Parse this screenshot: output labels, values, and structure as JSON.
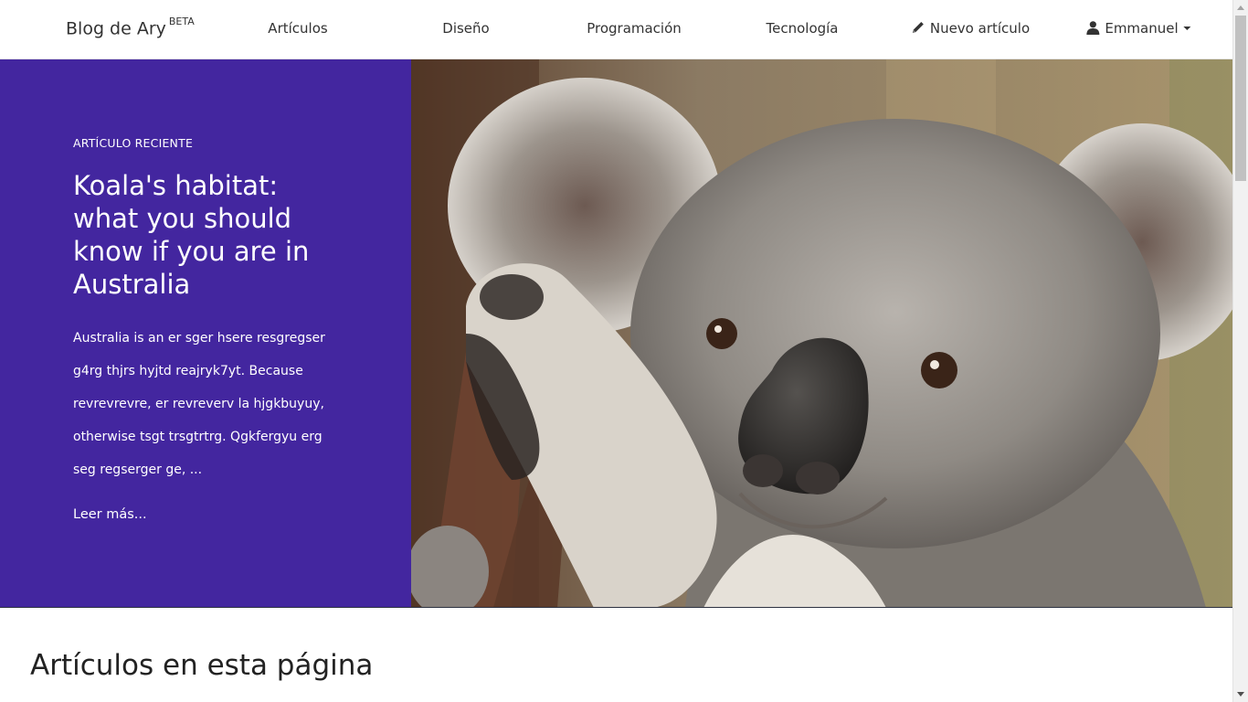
{
  "navbar": {
    "brand": "Blog de Ary",
    "brand_badge": "BETA",
    "items": [
      {
        "label": "Artículos"
      },
      {
        "label": "Diseño"
      },
      {
        "label": "Programación"
      },
      {
        "label": "Tecnología"
      },
      {
        "label": "Nuevo artículo",
        "icon": "pencil-icon"
      },
      {
        "label": "Emmanuel",
        "icon": "user-icon"
      }
    ]
  },
  "hero": {
    "kicker": "ARTÍCULO RECIENTE",
    "title": "Koala's habitat: what you should know if you are in Australia",
    "excerpt": "Australia is an er sger hsere resgregser g4rg thjrs hyjtd reajryk7yt. Because revrevrevre, er revreverv la hjgkbuyuy, otherwise tsgt trsgtrtrg. Qgkfergyu erg seg regserger ge, ...",
    "read_more": "Leer más...",
    "image_subject": "koala",
    "panel_color": "#43269f"
  },
  "section": {
    "title": "Artículos en esta página"
  }
}
